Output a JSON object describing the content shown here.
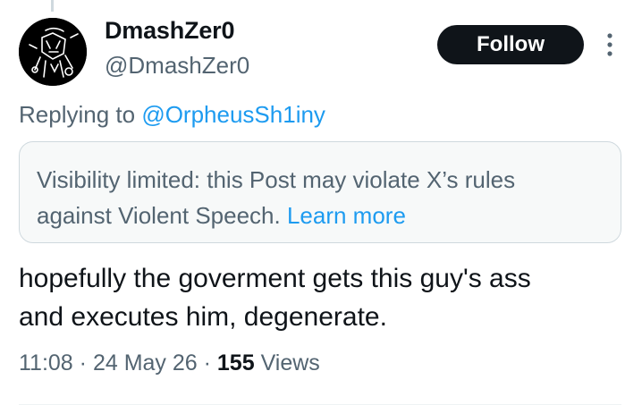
{
  "author": {
    "display_name": "DmashZer0",
    "handle": "@DmashZer0"
  },
  "follow_label": "Follow",
  "reply": {
    "prefix": "Replying to ",
    "mention": "@OrpheusSh1iny"
  },
  "notice": {
    "text_line1": "Visibility limited: this Post may violate X’s rules",
    "text_line2": "against Violent Speech. ",
    "link": "Learn more"
  },
  "tweet": {
    "line1": "hopefully the goverment gets this guy's ass",
    "line2": "and executes him, degenerate."
  },
  "meta": {
    "time": "11:08",
    "sep1": " · ",
    "date": "24 May 26",
    "sep2": " · ",
    "views_count": "155",
    "views_label": " Views"
  },
  "icons": {
    "more": "more-vertical-icon"
  },
  "colors": {
    "accent": "#1d9bf0",
    "text_primary": "#0f1419",
    "text_secondary": "#536471",
    "notice_bg": "#f7f9f9",
    "border": "#cfd9de"
  }
}
